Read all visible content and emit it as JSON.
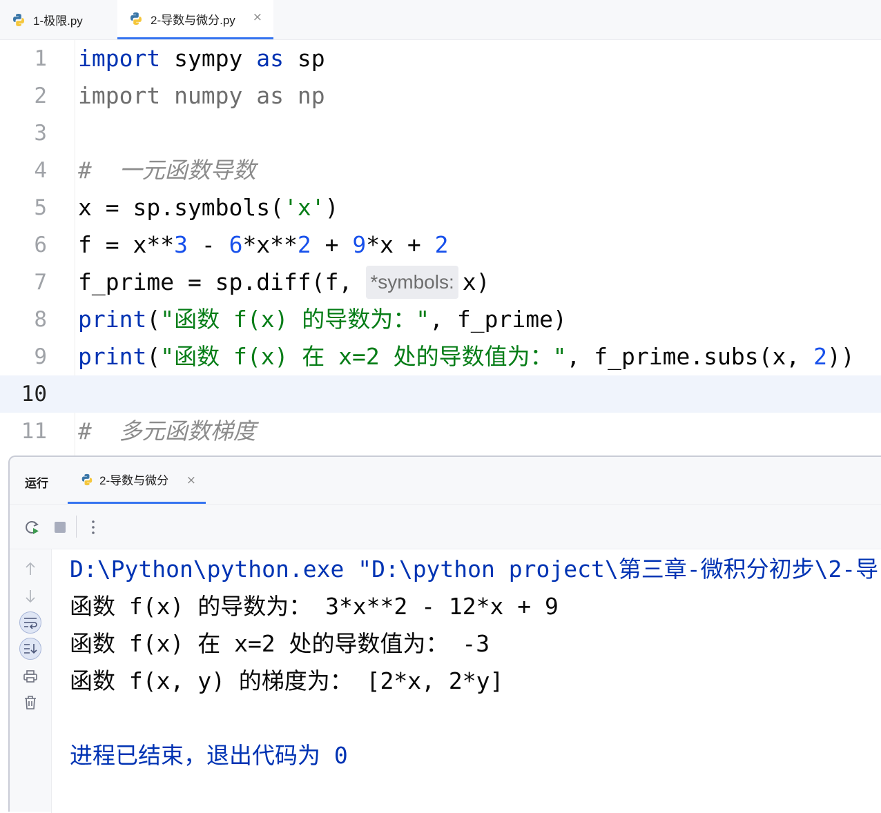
{
  "tabs": [
    {
      "label": "1-极限.py",
      "active": false
    },
    {
      "label": "2-导数与微分.py",
      "active": true,
      "close": "×"
    }
  ],
  "editor": {
    "lines": [
      {
        "num": "1"
      },
      {
        "num": "2"
      },
      {
        "num": "3"
      },
      {
        "num": "4"
      },
      {
        "num": "5"
      },
      {
        "num": "6"
      },
      {
        "num": "7"
      },
      {
        "num": "8"
      },
      {
        "num": "9"
      },
      {
        "num": "10"
      },
      {
        "num": "11"
      }
    ],
    "code": {
      "l1": {
        "kw1": "import",
        "mid": " sympy ",
        "kw2": "as",
        "end": " sp"
      },
      "l2": {
        "text": "import numpy as np"
      },
      "l4": {
        "text": "#  一元函数导数"
      },
      "l5": {
        "a": "x = sp.symbols(",
        "s": "'x'",
        "b": ")"
      },
      "l6": {
        "a": "f = x**",
        "n1": "3",
        "b": " - ",
        "n2": "6",
        "c": "*x**",
        "n3": "2",
        "d": " + ",
        "n4": "9",
        "e": "*x + ",
        "n5": "2"
      },
      "l7": {
        "a": "f_prime = sp.diff(f,",
        "hint": "*symbols:",
        "b": "x)"
      },
      "l8": {
        "kw": "print",
        "a": "(",
        "s": "\"函数 f(x) 的导数为：\"",
        "b": ", f_prime)"
      },
      "l9": {
        "kw": "print",
        "a": "(",
        "s": "\"函数 f(x) 在 x=2 处的导数值为：\"",
        "b": ", f_prime.subs(x, ",
        "n": "2",
        "c": "))"
      },
      "l11": {
        "text": "#  多元函数梯度"
      }
    },
    "current_line": "10"
  },
  "run_panel": {
    "label": "运行",
    "tab_label": "2-导数与微分",
    "tab_close": "×",
    "console": [
      "D:\\Python\\python.exe \"D:\\python project\\第三章-微积分初步\\2-导",
      "函数 f(x) 的导数为： 3*x**2 - 12*x + 9",
      "函数 f(x) 在 x=2 处的导数值为： -3",
      "函数 f(x, y) 的梯度为： [2*x, 2*y]",
      "",
      "进程已结束，退出代码为 0"
    ]
  },
  "colors": {
    "keyword": "#0033b3",
    "number": "#1750eb",
    "string": "#067d17",
    "comment": "#8c8c8c",
    "accent": "#3574f0",
    "current_line_bg": "#f0f4fc"
  },
  "icons": [
    "python-file-icon",
    "rerun-icon",
    "stop-icon",
    "more-vertical-icon",
    "arrow-up-icon",
    "arrow-down-icon",
    "soft-wrap-icon",
    "scroll-to-end-icon",
    "print-icon",
    "trash-icon"
  ]
}
